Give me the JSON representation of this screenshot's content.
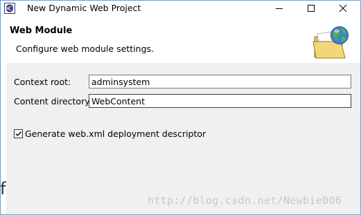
{
  "window": {
    "title": "New Dynamic Web Project",
    "buttons": {
      "minimize": "minimize",
      "maximize": "maximize",
      "close": "close"
    }
  },
  "header": {
    "title": "Web Module",
    "description": "Configure web module settings.",
    "graphic": "folder-globe-icon"
  },
  "form": {
    "context_root": {
      "label": "Context root:",
      "value": "adminsystem"
    },
    "content_directory": {
      "label": "Content directory:",
      "value": "WebContent"
    },
    "generate_web_xml": {
      "label": "Generate web.xml deployment descriptor",
      "checked": true
    }
  },
  "background_fragment": "f",
  "watermark": "http://blog.csdn.net/Newbie006",
  "colors": {
    "header_bg": "#ffffff",
    "body_bg": "#f0f0f0",
    "window_border": "#7a9cc6",
    "watermark": "#c8c8c8"
  }
}
